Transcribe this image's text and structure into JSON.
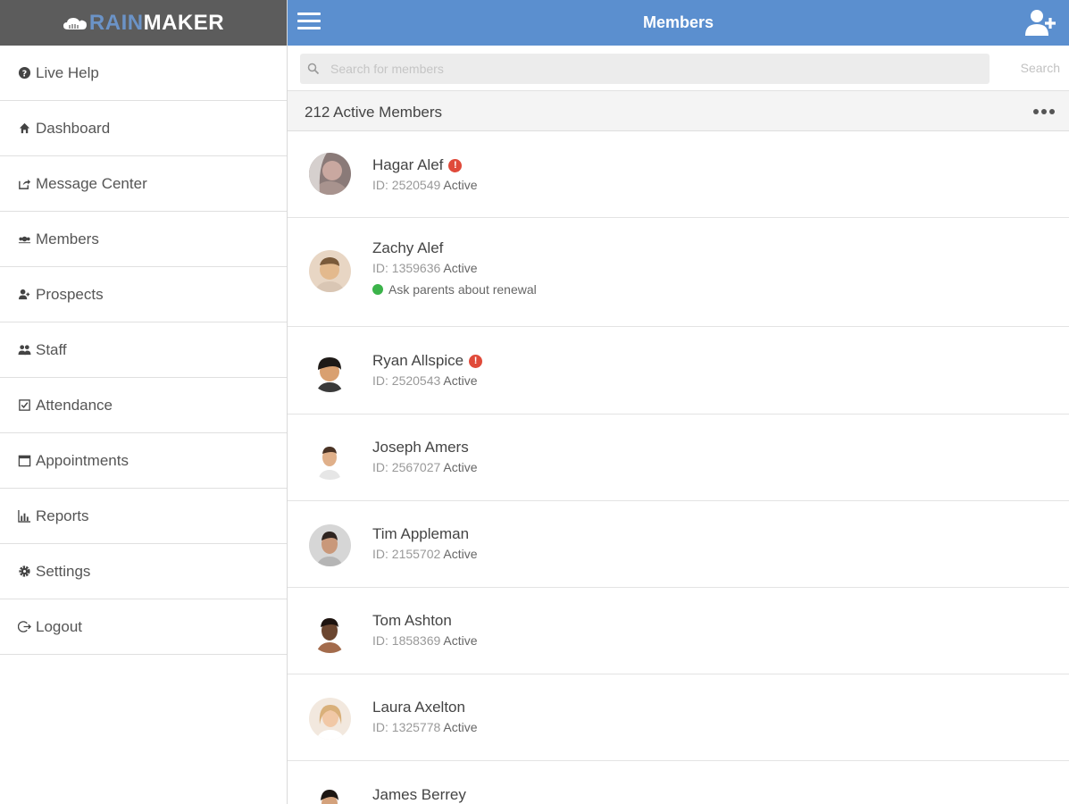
{
  "brand": {
    "part1": "RAIN",
    "part2": "MAKER"
  },
  "sidebar": {
    "items": [
      {
        "label": "Live Help",
        "icon": "question-circle-icon"
      },
      {
        "label": "Dashboard",
        "icon": "home-icon"
      },
      {
        "label": "Message Center",
        "icon": "share-icon"
      },
      {
        "label": "Members",
        "icon": "members-icon"
      },
      {
        "label": "Prospects",
        "icon": "user-plus-icon"
      },
      {
        "label": "Staff",
        "icon": "group-icon"
      },
      {
        "label": "Attendance",
        "icon": "checkbox-icon"
      },
      {
        "label": "Appointments",
        "icon": "calendar-icon"
      },
      {
        "label": "Reports",
        "icon": "bar-chart-icon"
      },
      {
        "label": "Settings",
        "icon": "gear-icon"
      },
      {
        "label": "Logout",
        "icon": "logout-icon"
      }
    ]
  },
  "header": {
    "title": "Members"
  },
  "search": {
    "placeholder": "Search for members",
    "button_label": "Search"
  },
  "summary": {
    "count_label": "212 Active Members"
  },
  "members": [
    {
      "name": "Hagar Alef",
      "id_label": "ID: 2520549",
      "status": "Active",
      "alert": "!",
      "note": ""
    },
    {
      "name": "Zachy Alef",
      "id_label": "ID: 1359636",
      "status": "Active",
      "alert": "",
      "note": "Ask parents about renewal"
    },
    {
      "name": "Ryan Allspice",
      "id_label": "ID: 2520543",
      "status": "Active",
      "alert": "!",
      "note": ""
    },
    {
      "name": "Joseph Amers",
      "id_label": "ID: 2567027",
      "status": "Active",
      "alert": "",
      "note": ""
    },
    {
      "name": "Tim Appleman",
      "id_label": "ID: 2155702",
      "status": "Active",
      "alert": "",
      "note": ""
    },
    {
      "name": "Tom Ashton",
      "id_label": "ID: 1858369",
      "status": "Active",
      "alert": "",
      "note": ""
    },
    {
      "name": "Laura Axelton",
      "id_label": "ID: 1325778",
      "status": "Active",
      "alert": "",
      "note": ""
    },
    {
      "name": "James Berrey",
      "id_label": "",
      "status": "",
      "alert": "",
      "note": ""
    }
  ],
  "colors": {
    "header_bg": "#5b8fcf",
    "brand_bg": "#5c5c5c",
    "brand_accent": "#6b93c7",
    "alert": "#e04a3a",
    "note_dot": "#3bb34a"
  }
}
